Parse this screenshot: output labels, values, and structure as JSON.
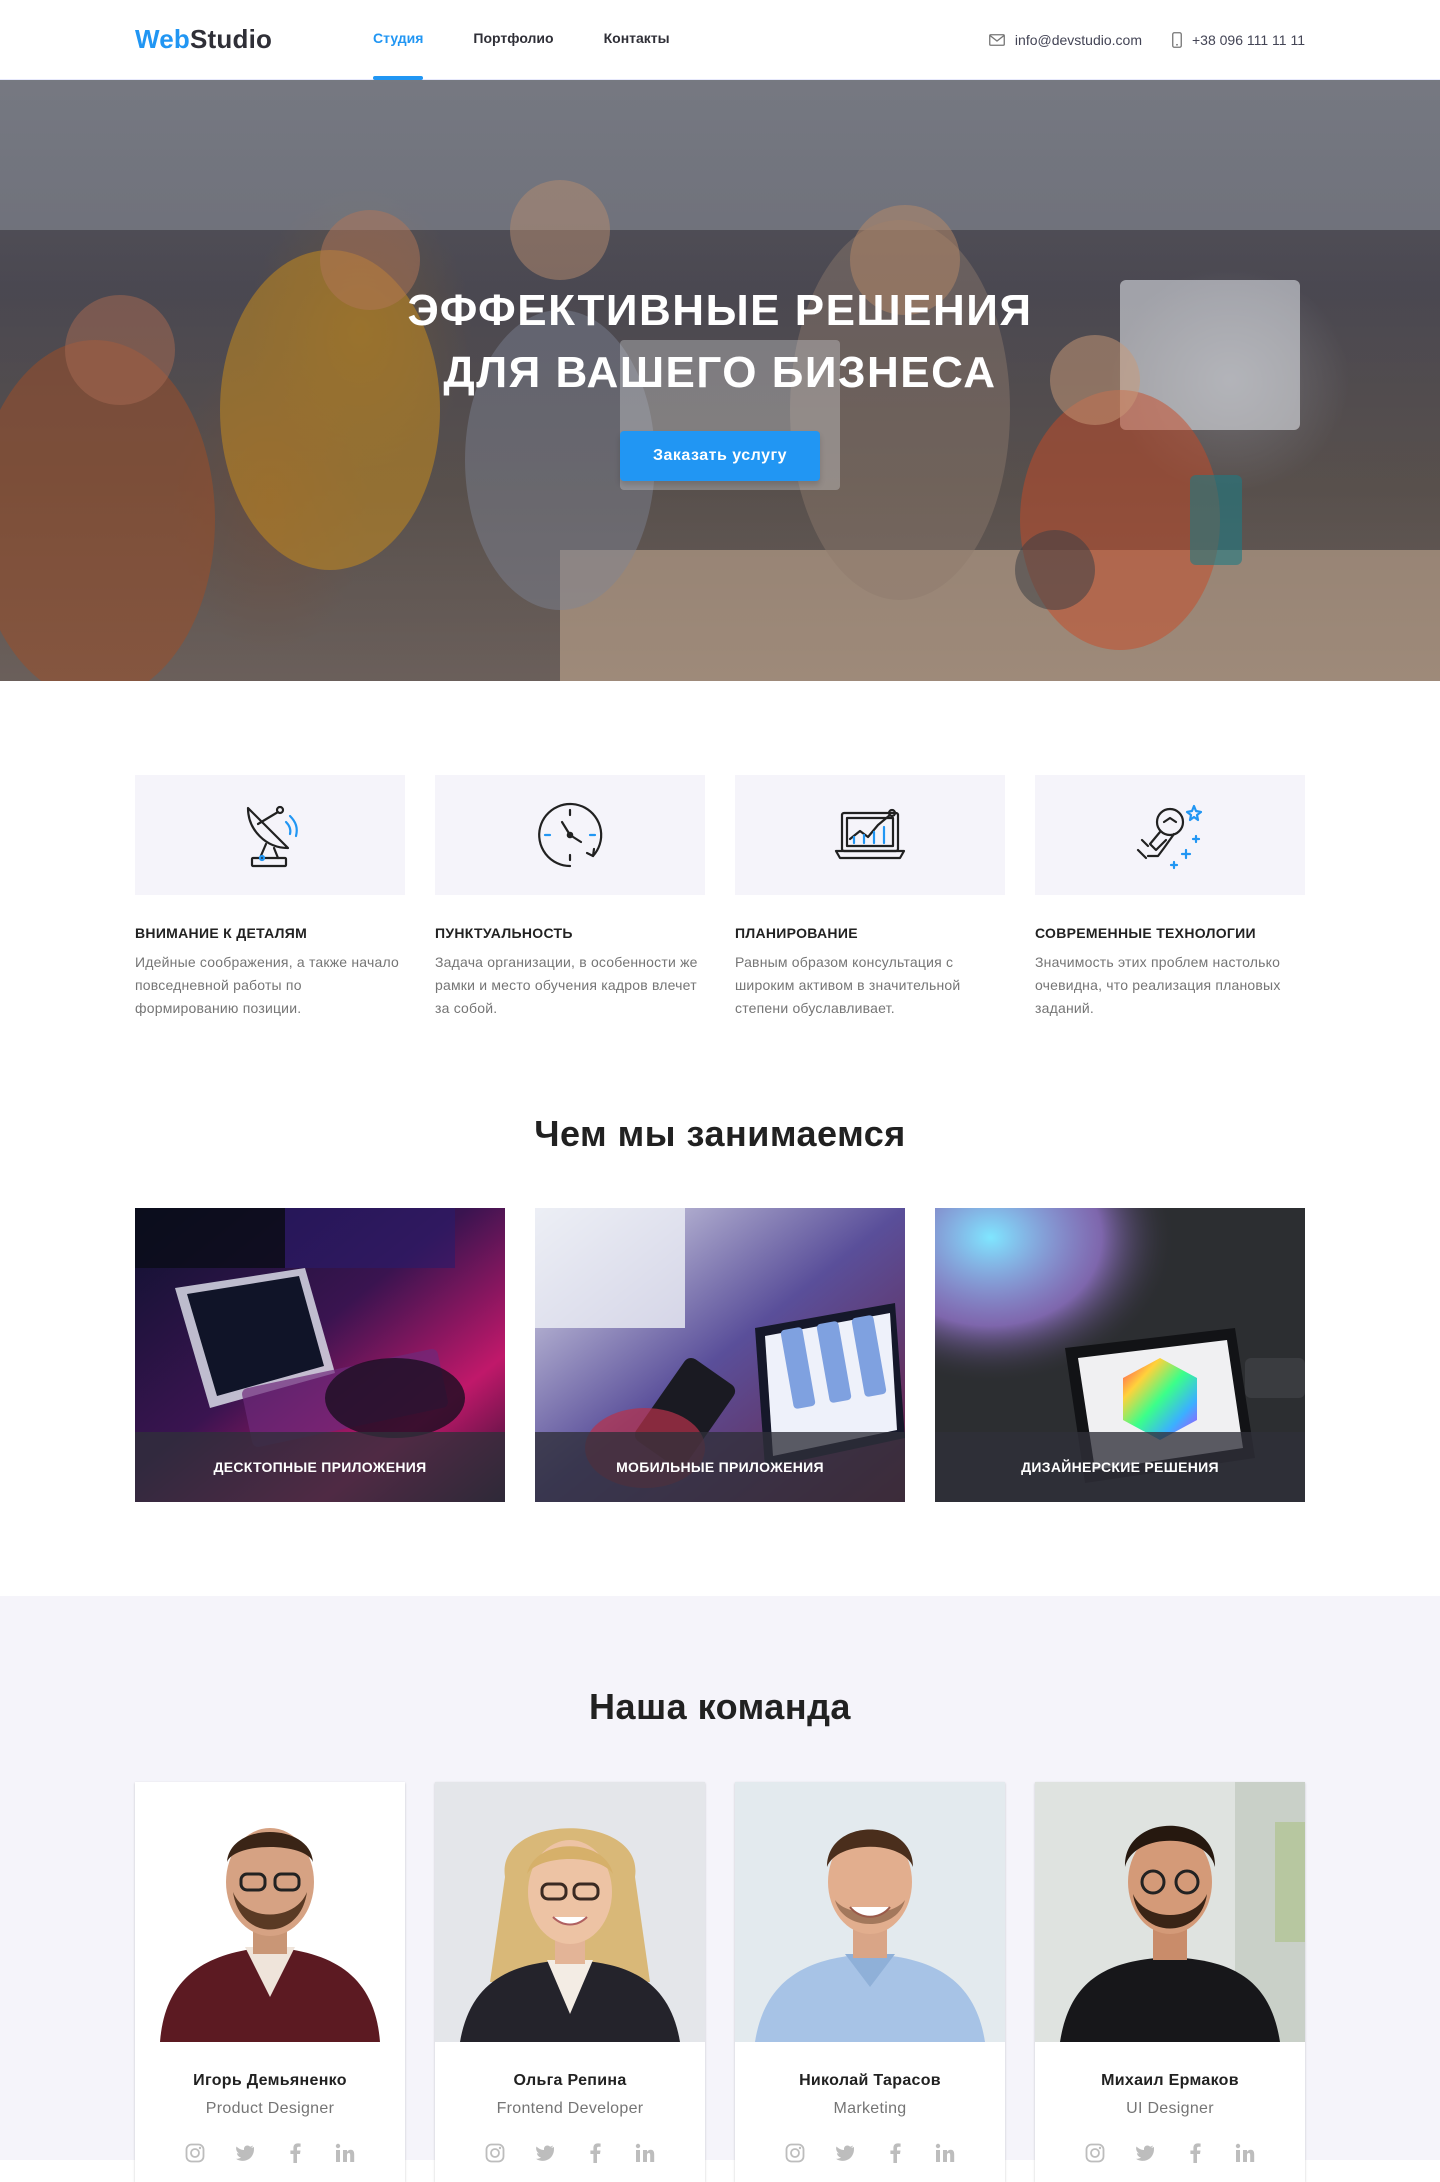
{
  "header": {
    "logo_part1": "Web",
    "logo_part2": "Studio",
    "nav": [
      {
        "label": "Студия",
        "active": true
      },
      {
        "label": "Портфолио",
        "active": false
      },
      {
        "label": "Контакты",
        "active": false
      }
    ],
    "email": "info@devstudio.com",
    "phone": "+38 096 111 11 11",
    "email_icon": "envelope-icon",
    "phone_icon": "smartphone-icon"
  },
  "hero": {
    "title_line1": "Эффективные решения",
    "title_line2": "для вашего бизнеса",
    "button_label": "Заказать услугу"
  },
  "features": [
    {
      "icon": "antenna-icon",
      "title": "Внимание к деталям",
      "text": "Идейные соображения, а также начало повседневной работы по формированию позиции."
    },
    {
      "icon": "clock-icon",
      "title": "Пунктуальность",
      "text": "Задача организации, в особенности же рамки и место обучения кадров влечет за собой."
    },
    {
      "icon": "laptop-chart-icon",
      "title": "Планирование",
      "text": "Равным образом консультация с широким активом в значительной степени обуславливает."
    },
    {
      "icon": "astronaut-icon",
      "title": "Современные технологии",
      "text": "Значимость этих проблем настолько очевидна, что реализация плановых заданий."
    }
  ],
  "services": {
    "title": "Чем мы занимаемся",
    "items": [
      {
        "label": "Десктопные приложения"
      },
      {
        "label": "Мобильные приложения"
      },
      {
        "label": "Дизайнерские решения"
      }
    ]
  },
  "team": {
    "title": "Наша команда",
    "members": [
      {
        "name": "Игорь Демьяненко",
        "role": "Product Designer"
      },
      {
        "name": "Ольга Репина",
        "role": "Frontend Developer"
      },
      {
        "name": "Николай Тарасов",
        "role": "Marketing"
      },
      {
        "name": "Михаил Ермаков",
        "role": "UI Designer"
      }
    ],
    "social_icons": [
      "instagram-icon",
      "twitter-icon",
      "facebook-icon",
      "linkedin-icon"
    ]
  },
  "colors": {
    "accent": "#2196f3",
    "dark": "#2f2f37",
    "text_muted": "#757575",
    "section_bg": "#f5f4fa"
  }
}
